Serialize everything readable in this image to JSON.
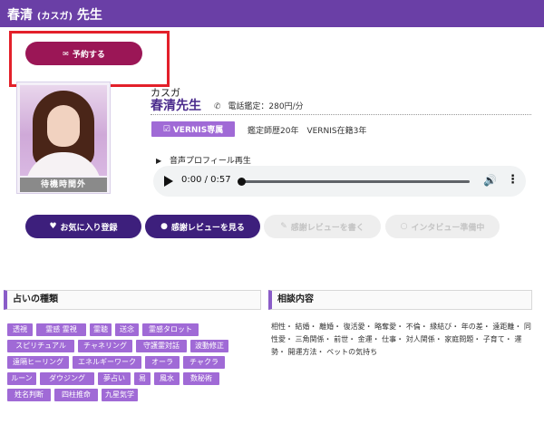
{
  "header": {
    "title_name": "春清",
    "title_reading": "(カスガ)",
    "title_suffix": "先生"
  },
  "reserve_button": {
    "icon": "envelope-icon",
    "label": "予約する"
  },
  "profile": {
    "status": "待機時間外",
    "reading": "カスガ",
    "name": "春清先生",
    "phone_icon": "phone-icon",
    "phone_rate": "電話鑑定：280円/分",
    "badge": "VERNIS専属",
    "experience": "鑑定師歴20年　VERNIS在籍3年"
  },
  "voice": {
    "label": "音声プロフィール再生",
    "time": "0:00 / 0:57"
  },
  "actions": {
    "favorite": "お気に入り登録",
    "view_reviews": "感謝レビューを見る",
    "write_review": "感謝レビューを書く",
    "interview": "インタビュー準備中"
  },
  "fortune_types": {
    "heading": "占いの種類",
    "tags": [
      "透視",
      "霊感 霊視",
      "霊聴",
      "送念",
      "霊感タロット",
      "スピリチュアル",
      "チャネリング",
      "守護霊対話",
      "波動修正",
      "遠隔ヒーリング",
      "エネルギーワーク",
      "オーラ",
      "チャクラ",
      "ルーン",
      "ダウジング",
      "夢占い",
      "易",
      "風水",
      "数秘術",
      "姓名判断",
      "四柱推命",
      "九星気学"
    ]
  },
  "consultation": {
    "heading": "相談内容",
    "text": "相性・ 結婚・ 離婚・ 復活愛・ 略奪愛・ 不倫・ 縁結び・ 年の差・ 遠距離・ 同性愛・ 三角関係・ 前世・ 金運・ 仕事・ 対人関係・ 家庭問題・ 子育て・ 運勢・ 開運方法・ ペットの気持ち"
  },
  "colors": {
    "header": "#6a3fa6",
    "reserve": "#9b1656",
    "primary_button": "#3d1f7c",
    "tag": "#a06ad6",
    "highlight": "#e3202a"
  }
}
